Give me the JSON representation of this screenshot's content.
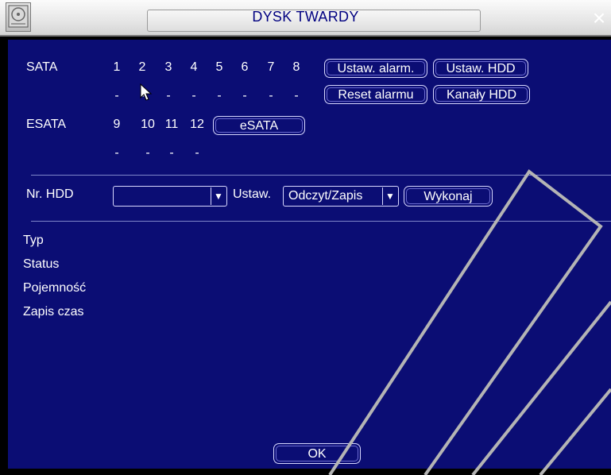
{
  "window": {
    "title": "DYSK TWARDY",
    "close_glyph": "×",
    "title_icon": "hdd-icon"
  },
  "sata": {
    "label": "SATA",
    "ports": [
      "1",
      "2",
      "3",
      "4",
      "5",
      "6",
      "7",
      "8"
    ],
    "status": [
      "-",
      "-",
      "-",
      "-",
      "-",
      "-",
      "-",
      "-"
    ]
  },
  "esata": {
    "label": "ESATA",
    "ports": [
      "9",
      "10",
      "11",
      "12"
    ],
    "status": [
      "-",
      "-",
      "-",
      "-"
    ],
    "button": "eSATA"
  },
  "buttons": {
    "alarm_settings": "Ustaw. alarm.",
    "hdd_settings": "Ustaw. HDD",
    "reset_alarm": "Reset alarmu",
    "hdd_channels": "Kanały HDD",
    "execute": "Wykonaj",
    "ok": "OK"
  },
  "hdd_row": {
    "label": "Nr. HDD",
    "hdd_value": "",
    "set_label": "Ustaw.",
    "mode_value": "Odczyt/Zapis"
  },
  "info": {
    "type_label": "Typ",
    "status_label": "Status",
    "capacity_label": "Pojemność",
    "record_time_label": "Zapis czas"
  },
  "colors": {
    "panel_bg": "#0b0d74",
    "title_text": "#000080"
  }
}
